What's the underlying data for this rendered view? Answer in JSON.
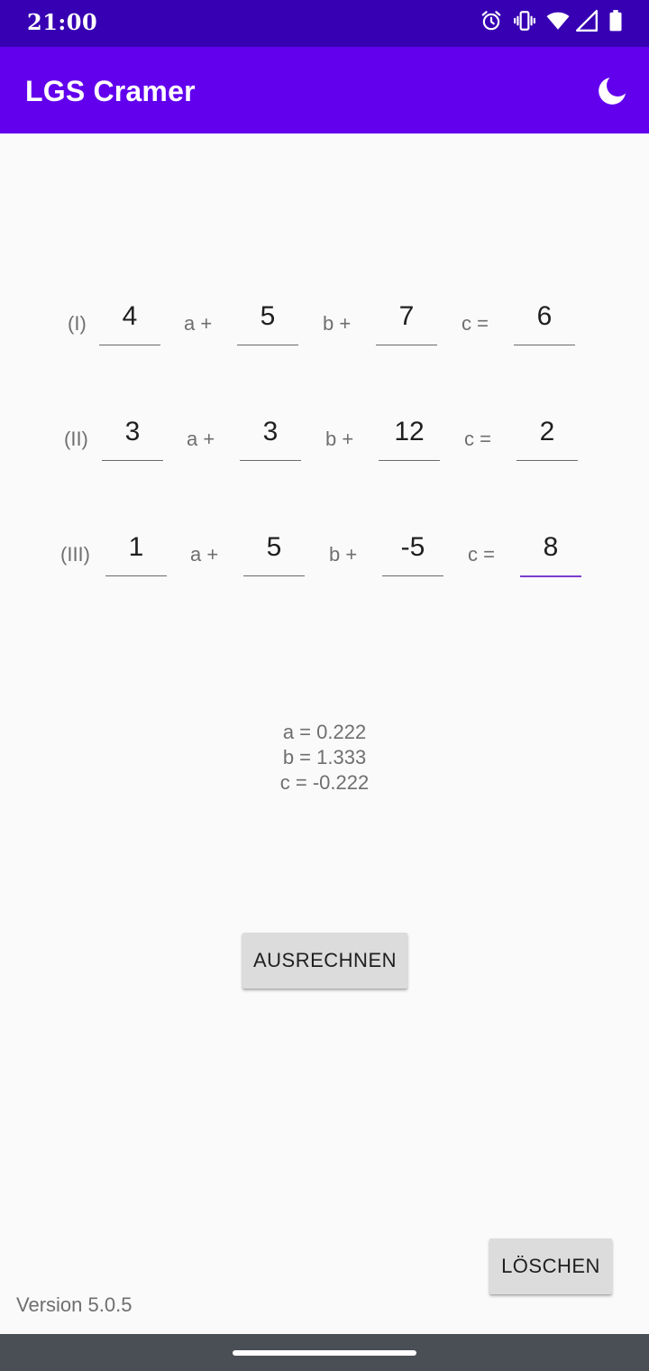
{
  "status_bar": {
    "time": "21:00",
    "icons": [
      "alarm-icon",
      "vibrate-icon",
      "wifi-icon",
      "signal-icon",
      "battery-icon"
    ]
  },
  "app_bar": {
    "title": "LGS Cramer",
    "theme_toggle_icon": "moon-icon"
  },
  "equations": [
    {
      "label": "(I)",
      "a": "4",
      "a_label": "a +",
      "b": "5",
      "b_label": "b +",
      "c": "7",
      "c_label": "c =",
      "rhs": "6"
    },
    {
      "label": "(II)",
      "a": "3",
      "a_label": "a +",
      "b": "3",
      "b_label": "b +",
      "c": "12",
      "c_label": "c =",
      "rhs": "2"
    },
    {
      "label": "(III)",
      "a": "1",
      "a_label": "a +",
      "b": "5",
      "b_label": "b +",
      "c": "-5",
      "c_label": "c =",
      "rhs": "8"
    }
  ],
  "results": {
    "a": "a = 0.222",
    "b": "b = 1.333",
    "c": "c = -0.222"
  },
  "buttons": {
    "calculate": "AUSRECHNEN",
    "clear": "LÖSCHEN"
  },
  "version": "Version 5.0.5",
  "colors": {
    "status_bar": "#3700b3",
    "app_bar": "#6200ee",
    "focus_underline": "#7c3bd0",
    "background": "#fafafa"
  }
}
